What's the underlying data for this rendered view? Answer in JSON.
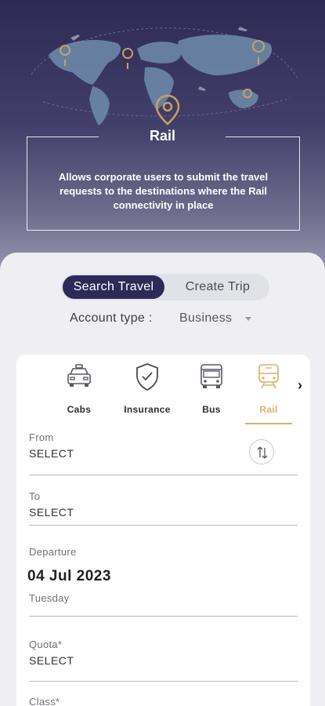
{
  "hero": {
    "title": "Rail",
    "description": "Allows corporate users to submit the travel requests to the destinations where the Rail connectivity in place",
    "icons": [
      "world-map-graphic",
      "location-pin-icon",
      "airplane-icon"
    ]
  },
  "toggle": {
    "active": "Search Travel",
    "inactive": "Create Trip"
  },
  "account": {
    "label": "Account type :",
    "value": "Business"
  },
  "modes": [
    {
      "label": "Cabs",
      "icon": "cab-icon"
    },
    {
      "label": "Insurance",
      "icon": "insurance-shield-icon"
    },
    {
      "label": "Bus",
      "icon": "bus-icon"
    },
    {
      "label": "Rail",
      "icon": "rail-icon",
      "selected": true
    }
  ],
  "form": {
    "from": {
      "label": "From",
      "value": "SELECT"
    },
    "to": {
      "label": "To",
      "value": "SELECT"
    },
    "departure": {
      "label": "Departure",
      "date": "04 Jul 2023",
      "day": "Tuesday"
    },
    "quota": {
      "label": "Quota*",
      "value": "SELECT"
    },
    "class": {
      "label": "Class*"
    }
  },
  "colors": {
    "primary": "#2d2a57",
    "accent": "#d6b36a",
    "gold_pin": "#c9a25e"
  }
}
